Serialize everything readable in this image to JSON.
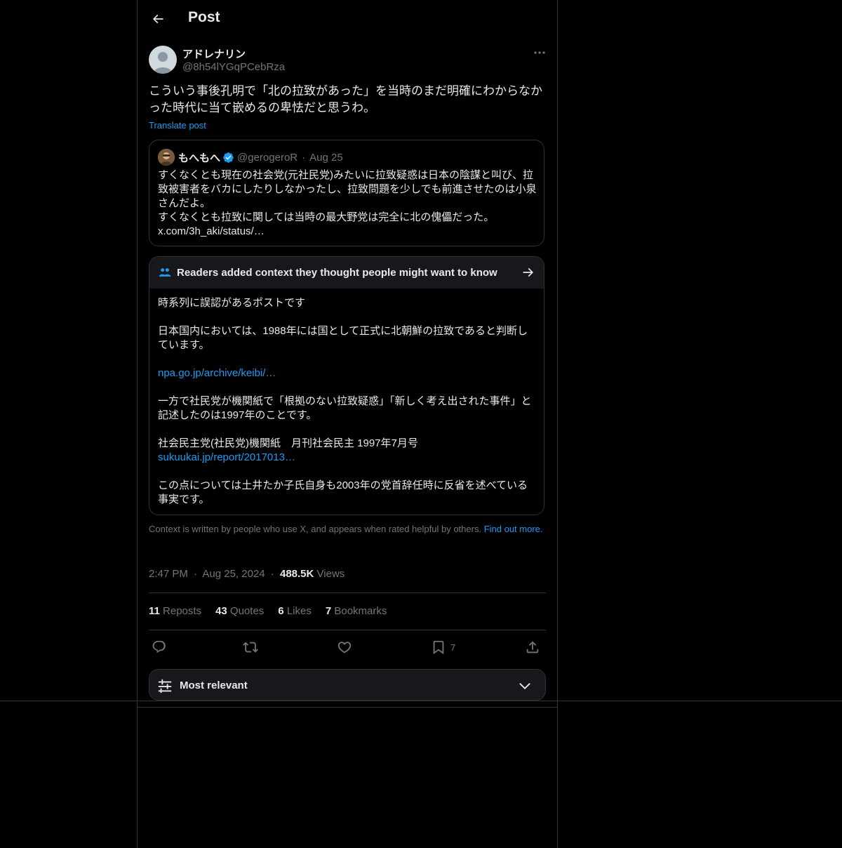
{
  "header": {
    "title": "Post",
    "back_icon": "arrow-left-icon"
  },
  "post": {
    "author_name": "アドレナリン",
    "author_handle": "@8h54lYGqPCebRza",
    "text": "こういう事後孔明で「北の拉致があった」を当時のまだ明確にわからなかった時代に当て嵌めるの卑怯だと思うわ。",
    "translate_label": "Translate post"
  },
  "quote": {
    "name": "もへもへ",
    "handle": "@gerogeroR",
    "separator": "·",
    "date": "Aug 25",
    "text_lines": [
      "すくなくとも現在の社会党(元社民党)みたいに拉致疑惑は日本の陰謀と叫び、拉致被害者をバカにしたりしなかったし、拉致問題を少しでも前進させたのは小泉さんだよ。",
      "すくなくとも拉致に関しては当時の最大野党は完全に北の傀儡だった。",
      "x.com/3h_aki/status/…"
    ]
  },
  "community_note": {
    "header": "Readers added context they thought people might want to know",
    "p1": "時系列に誤認があるポストです",
    "p2": "日本国内においては、1988年には国として正式に北朝鮮の拉致であると判断しています。",
    "link1": "npa.go.jp/archive/keibi/…",
    "p3": "一方で社民党が機関紙で「根拠のない拉致疑惑」「新しく考え出された事件」と記述したのは1997年のことです。",
    "p4": "社会民主党(社民党)機関紙　月刊社会民主 1997年7月号",
    "link2": "sukuukai.jp/report/2017013…",
    "p5": "この点については土井たか子氏自身も2003年の党首辞任時に反省を述べている事実です。",
    "footer_text": "Context is written by people who use X, and appears when rated helpful by others.",
    "footer_link": "Find out more."
  },
  "meta": {
    "time": "2:47 PM",
    "separator": "·",
    "date": "Aug 25, 2024",
    "views_count": "488.5K",
    "views_label": "Views"
  },
  "stats": {
    "reposts_count": "11",
    "reposts_label": "Reposts",
    "quotes_count": "43",
    "quotes_label": "Quotes",
    "likes_count": "6",
    "likes_label": "Likes",
    "bookmarks_count": "7",
    "bookmarks_label": "Bookmarks"
  },
  "actions": {
    "bookmark_count": "7"
  },
  "sort": {
    "label": "Most relevant"
  },
  "colors": {
    "background": "#000000",
    "text": "#e7e9ea",
    "secondary": "#71767b",
    "accent": "#1d9bf0",
    "border": "#2f3336",
    "card": "#16181c"
  }
}
